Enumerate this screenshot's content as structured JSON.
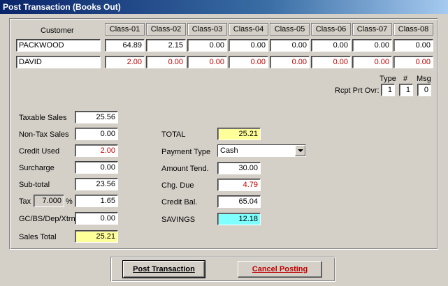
{
  "window": {
    "title": "Post Transaction (Books Out)"
  },
  "grid": {
    "customer_header": "Customer",
    "class_headers": [
      "Class-01",
      "Class-02",
      "Class-03",
      "Class-04",
      "Class-05",
      "Class-06",
      "Class-07",
      "Class-08"
    ],
    "rows": [
      {
        "name": "PACKWOOD",
        "values": [
          "64.89",
          "2.15",
          "0.00",
          "0.00",
          "0.00",
          "0.00",
          "0.00",
          "0.00"
        ],
        "color": "black"
      },
      {
        "name": "DAVID",
        "values": [
          "2.00",
          "0.00",
          "0.00",
          "0.00",
          "0.00",
          "0.00",
          "0.00",
          "0.00"
        ],
        "color": "red"
      }
    ]
  },
  "receipt": {
    "label": "Rcpt Prt Ovr:",
    "type_header": "Type",
    "num_header": "#",
    "msg_header": "Msg",
    "type_value": "1",
    "num_value": "1",
    "msg_value": "0"
  },
  "left": {
    "taxable_sales_label": "Taxable Sales",
    "taxable_sales": "25.56",
    "nontax_sales_label": "Non-Tax Sales",
    "nontax_sales": "0.00",
    "credit_used_label": "Credit Used",
    "credit_used": "2.00",
    "surcharge_label": "Surcharge",
    "surcharge": "0.00",
    "subtotal_label": "Sub-total",
    "subtotal": "23.56",
    "tax_label": "Tax",
    "tax_rate": "7.000",
    "tax_pct": "%",
    "tax": "1.65",
    "gc_label": "GC/BS/Dep/Xtrn",
    "gc": "0.00",
    "sales_total_label": "Sales Total",
    "sales_total": "25.21"
  },
  "right": {
    "total_label": "TOTAL",
    "total": "25.21",
    "payment_type_label": "Payment Type",
    "payment_type": "Cash",
    "amount_tend_label": "Amount Tend.",
    "amount_tend": "30.00",
    "chg_due_label": "Chg. Due",
    "chg_due": "4.79",
    "credit_bal_label": "Credit Bal.",
    "credit_bal": "65.04",
    "savings_label": "SAVINGS",
    "savings": "12.18"
  },
  "buttons": {
    "post": "Post Transaction",
    "cancel": "Cancel Posting"
  },
  "colors": {
    "red_text": "#c00000",
    "highlight_yellow": "#ffff99",
    "highlight_cyan": "#80ffff",
    "cancel_text": "#c00000"
  }
}
